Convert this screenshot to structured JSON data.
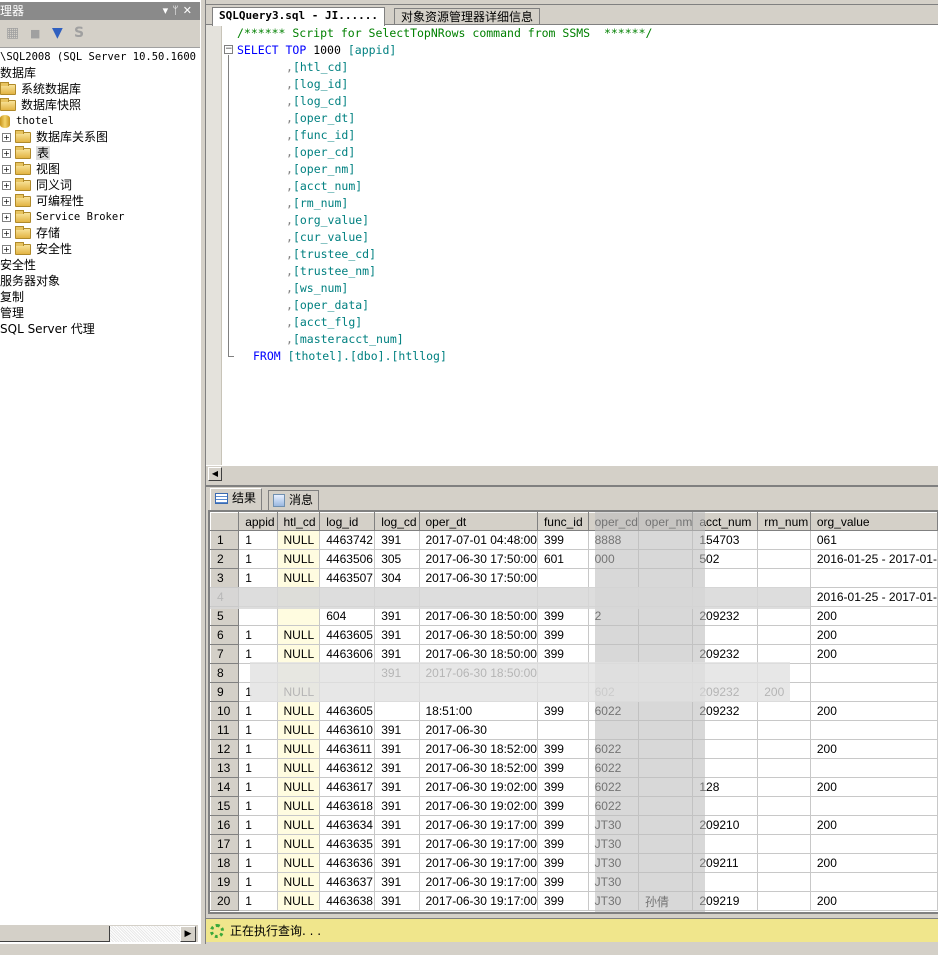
{
  "object_explorer": {
    "title": "理器",
    "controls": "▾ ᛘ ✕",
    "toolbar": [
      "connect-icon",
      "stop-icon",
      "filter-icon",
      "refresh-icon"
    ],
    "server": "\\SQL2008 (SQL Server 10.50.1600 -",
    "tree": [
      {
        "label": "数据库",
        "indent": 0,
        "kind": "text"
      },
      {
        "label": "系统数据库",
        "indent": 1,
        "kind": "folder"
      },
      {
        "label": "数据库快照",
        "indent": 1,
        "kind": "folder"
      },
      {
        "label": "thotel",
        "indent": 1,
        "kind": "db"
      },
      {
        "label": "数据库关系图",
        "indent": 2,
        "kind": "folder"
      },
      {
        "label": "表",
        "indent": 2,
        "kind": "folder",
        "selected": true
      },
      {
        "label": "视图",
        "indent": 2,
        "kind": "folder"
      },
      {
        "label": "同义词",
        "indent": 2,
        "kind": "folder"
      },
      {
        "label": "可编程性",
        "indent": 2,
        "kind": "folder"
      },
      {
        "label": "Service Broker",
        "indent": 2,
        "kind": "folder"
      },
      {
        "label": "存储",
        "indent": 2,
        "kind": "folder"
      },
      {
        "label": "安全性",
        "indent": 2,
        "kind": "folder"
      },
      {
        "label": "安全性",
        "indent": 0,
        "kind": "text"
      },
      {
        "label": "服务器对象",
        "indent": 0,
        "kind": "text"
      },
      {
        "label": "复制",
        "indent": 0,
        "kind": "text"
      },
      {
        "label": "管理",
        "indent": 0,
        "kind": "text"
      },
      {
        "label": "SQL Server 代理",
        "indent": 0,
        "kind": "text"
      }
    ]
  },
  "tabs": [
    {
      "label": "SQLQuery3.sql - JI......",
      "active": true
    },
    {
      "label": "对象资源管理器详细信息",
      "active": false
    }
  ],
  "editor": {
    "comment": "/****** Script for SelectTopNRows command from SSMS  ******/",
    "select_kw": "SELECT",
    "top_kw": "TOP",
    "top_n": "1000",
    "first_col": "[appid]",
    "columns": [
      "[htl_cd]",
      "[log_id]",
      "[log_cd]",
      "[oper_dt]",
      "[func_id]",
      "[oper_cd]",
      "[oper_nm]",
      "[acct_num]",
      "[rm_num]",
      "[org_value]",
      "[cur_value]",
      "[trustee_cd]",
      "[trustee_nm]",
      "[ws_num]",
      "[oper_data]",
      "[acct_flg]",
      "[masteracct_num]"
    ],
    "from_kw": "FROM",
    "from_target": "[thotel].[dbo].[htllog]"
  },
  "result_tabs": [
    {
      "label": "结果",
      "icon": "grid-icon",
      "active": true
    },
    {
      "label": "消息",
      "icon": "messages-icon",
      "active": false
    }
  ],
  "grid": {
    "columns": [
      "appid",
      "htl_cd",
      "log_id",
      "log_cd",
      "oper_dt",
      "func_id",
      "oper_cd",
      "oper_nm",
      "acct_num",
      "rm_num",
      "org_value"
    ],
    "rows": [
      [
        "1",
        "1",
        "NULL",
        "4463742",
        "391",
        "2017-07-01 04:48:00",
        "399",
        "8888",
        "",
        "154703",
        "",
        "061"
      ],
      [
        "2",
        "1",
        "NULL",
        "4463506",
        "305",
        "2017-06-30 17:50:00",
        "601",
        "000",
        "",
        "502",
        "",
        "2016-01-25 - 2017-01-"
      ],
      [
        "3",
        "1",
        "NULL",
        "4463507",
        "304",
        "2017-06-30 17:50:00",
        "",
        "",
        "",
        "",
        "",
        ""
      ],
      [
        "4",
        "",
        "",
        "",
        "",
        "",
        "",
        "",
        "",
        "",
        "",
        "2016-01-25 - 2017-01-"
      ],
      [
        "5",
        "",
        "",
        "604",
        "391",
        "2017-06-30 18:50:00",
        "399",
        "2",
        "",
        "209232",
        "",
        "200"
      ],
      [
        "6",
        "1",
        "NULL",
        "4463605",
        "391",
        "2017-06-30 18:50:00",
        "399",
        "",
        "",
        "",
        "",
        "200"
      ],
      [
        "7",
        "1",
        "NULL",
        "4463606",
        "391",
        "2017-06-30 18:50:00",
        "399",
        "",
        "",
        "209232",
        "",
        "200"
      ],
      [
        "8",
        "",
        "",
        "",
        "391",
        "2017-06-30 18:50:00",
        "",
        "",
        "",
        "",
        "",
        ""
      ],
      [
        "9",
        "1",
        "NULL",
        "",
        "",
        "",
        "",
        "602",
        "",
        "209232",
        "200",
        ""
      ],
      [
        "10",
        "1",
        "NULL",
        "4463605",
        "",
        "18:51:00",
        "399",
        "6022",
        "",
        "209232",
        "",
        "200"
      ],
      [
        "11",
        "1",
        "NULL",
        "4463610",
        "391",
        "2017-06-30",
        "",
        "",
        "",
        "",
        "",
        ""
      ],
      [
        "12",
        "1",
        "NULL",
        "4463611",
        "391",
        "2017-06-30 18:52:00",
        "399",
        "6022",
        "",
        "",
        "",
        "200"
      ],
      [
        "13",
        "1",
        "NULL",
        "4463612",
        "391",
        "2017-06-30 18:52:00",
        "399",
        "6022",
        "",
        "",
        "",
        ""
      ],
      [
        "14",
        "1",
        "NULL",
        "4463617",
        "391",
        "2017-06-30 19:02:00",
        "399",
        "6022",
        "",
        "128",
        "",
        "200"
      ],
      [
        "15",
        "1",
        "NULL",
        "4463618",
        "391",
        "2017-06-30 19:02:00",
        "399",
        "6022",
        "",
        "",
        "",
        ""
      ],
      [
        "16",
        "1",
        "NULL",
        "4463634",
        "391",
        "2017-06-30 19:17:00",
        "399",
        "JT30",
        "",
        "209210",
        "",
        "200"
      ],
      [
        "17",
        "1",
        "NULL",
        "4463635",
        "391",
        "2017-06-30 19:17:00",
        "399",
        "JT30",
        "",
        "",
        "",
        ""
      ],
      [
        "18",
        "1",
        "NULL",
        "4463636",
        "391",
        "2017-06-30 19:17:00",
        "399",
        "JT30",
        "",
        "209211",
        "",
        "200"
      ],
      [
        "19",
        "1",
        "NULL",
        "4463637",
        "391",
        "2017-06-30 19:17:00",
        "399",
        "JT30",
        "",
        "",
        "",
        ""
      ],
      [
        "20",
        "1",
        "NULL",
        "4463638",
        "391",
        "2017-06-30 19:17:00",
        "399",
        "JT30",
        "孙倩",
        "209219",
        "",
        "200"
      ]
    ]
  },
  "status": {
    "text": "正在执行查询. . .",
    "color": "#f0e68c"
  }
}
